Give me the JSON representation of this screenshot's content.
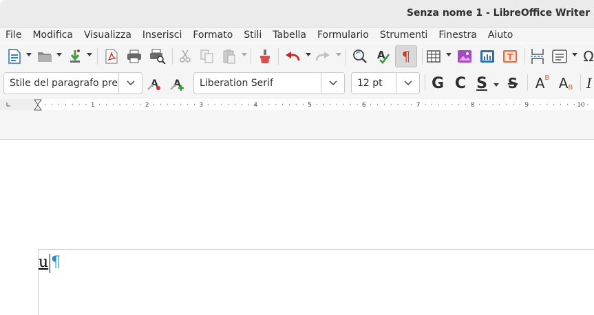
{
  "window": {
    "title": "Senza nome 1 - LibreOffice Writer"
  },
  "menu": [
    "File",
    "Modifica",
    "Visualizza",
    "Inserisci",
    "Formato",
    "Stili",
    "Tabella",
    "Formulario",
    "Strumenti",
    "Finestra",
    "Aiuto"
  ],
  "formatting": {
    "paragraph_style": "Stile del paragrafo pre",
    "font_name": "Liberation Serif",
    "font_size": "12 pt",
    "bold_label": "G",
    "italic_label": "C",
    "underline_label": "S",
    "strike_label": "S",
    "superscript_label": "A",
    "superscript_small": "B",
    "subscript_label": "A",
    "subscript_small": "B",
    "italic_ext_label": "I"
  },
  "ruler": {
    "labels": [
      "1",
      "2",
      "3",
      "4",
      "5",
      "6",
      "7",
      "8",
      "9",
      "10"
    ]
  },
  "document": {
    "text": "u",
    "formatting_mark": "¶"
  },
  "colors": {
    "accent_blue": "#2a89c8",
    "pdf_red": "#d8322b",
    "undo_red": "#c8262b"
  }
}
